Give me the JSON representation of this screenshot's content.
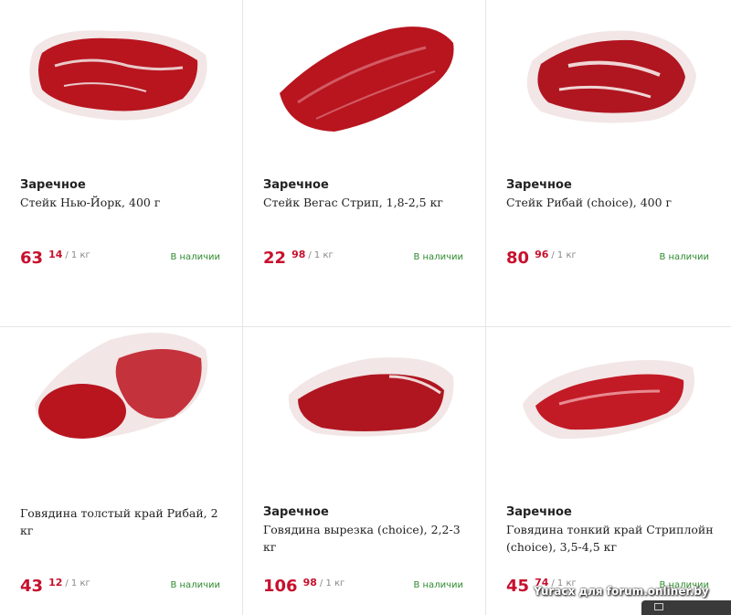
{
  "products": [
    {
      "brand": "Заречное",
      "name": "Стейк Нью-Йорк, 400 г",
      "price_rub": "63",
      "price_kop": "14",
      "unit": "/ 1 кг",
      "stock": "В наличии"
    },
    {
      "brand": "Заречное",
      "name": "Стейк Вегас Стрип, 1,8-2,5 кг",
      "price_rub": "22",
      "price_kop": "98",
      "unit": "/ 1 кг",
      "stock": "В наличии"
    },
    {
      "brand": "Заречное",
      "name": "Стейк Рибай (choice), 400 г",
      "price_rub": "80",
      "price_kop": "96",
      "unit": "/ 1 кг",
      "stock": "В наличии"
    },
    {
      "brand": "",
      "name": "Говядина толстый край Рибай, 2 кг",
      "price_rub": "43",
      "price_kop": "12",
      "unit": "/ 1 кг",
      "stock": "В наличии"
    },
    {
      "brand": "Заречное",
      "name": "Говядина вырезка (choice), 2,2-3 кг",
      "price_rub": "106",
      "price_kop": "98",
      "unit": "/ 1 кг",
      "stock": "В наличии"
    },
    {
      "brand": "Заречное",
      "name": "Говядина тонкий край Стриплойн (choice), 3,5-4,5 кг",
      "price_rub": "45",
      "price_kop": "74",
      "unit": "/ 1 кг",
      "stock": "В наличии"
    }
  ],
  "watermark": "Yuracx для forum.onliner.by",
  "colors": {
    "price": "#c8102e",
    "stock": "#2f8a2f",
    "meat": "#b8151f",
    "fat": "#f3e4e4"
  }
}
